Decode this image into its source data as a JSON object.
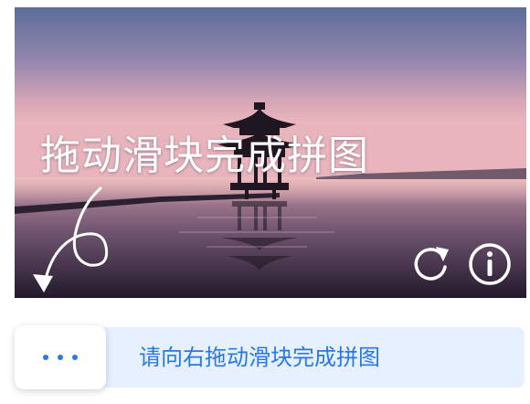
{
  "captcha": {
    "overlay_text": "拖动滑块完成拼图",
    "slider_instruction": "请向右拖动滑块完成拼图",
    "icons": {
      "refresh": "refresh-icon",
      "info": "info-icon",
      "hint_arrow": "curved-arrow-down-icon",
      "handle": "ellipsis-icon"
    },
    "colors": {
      "accent": "#2a78e4",
      "track": "#e7f0ff",
      "handle": "#ffffff"
    }
  }
}
